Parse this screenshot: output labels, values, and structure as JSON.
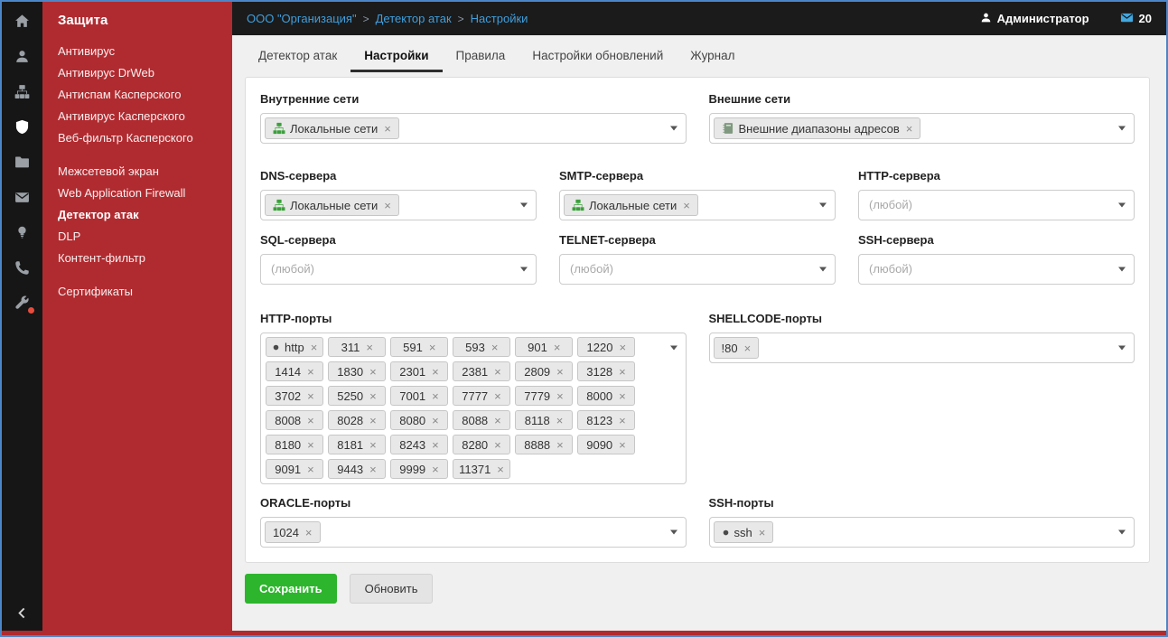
{
  "theme": {
    "border_blue": "#4a86c8",
    "sidebar_red": "#b02b30",
    "iconbar_dark": "#161616",
    "topbar_dark": "#1b1b1b",
    "content_bg": "#f0f0f0",
    "link_blue": "#3f9fdd",
    "save_green": "#2db52d",
    "tag_bg": "#e8e8e8",
    "badge_red": "#e74c3c",
    "mail_blue": "#41a8e0",
    "network_green": "#3ba03b",
    "book_gray": "#7f987f",
    "dot_gray": "#4a4a4a"
  },
  "iconbar": {
    "items": [
      {
        "id": "home",
        "icon": "home-icon"
      },
      {
        "id": "users",
        "icon": "user-icon"
      },
      {
        "id": "network",
        "icon": "network-icon"
      },
      {
        "id": "protection",
        "icon": "shield-icon",
        "active": true
      },
      {
        "id": "files",
        "icon": "folder-icon"
      },
      {
        "id": "mail",
        "icon": "mail-icon"
      },
      {
        "id": "monitoring",
        "icon": "lightbulb-icon"
      },
      {
        "id": "telephony",
        "icon": "phone-icon"
      },
      {
        "id": "services",
        "icon": "wrench-icon",
        "badge": true
      }
    ]
  },
  "sidebar": {
    "title": "Защита",
    "groups": [
      {
        "items": [
          {
            "id": "antivirus",
            "label": "Антивирус"
          },
          {
            "id": "antivirus-drweb",
            "label": "Антивирус DrWeb"
          },
          {
            "id": "antispam-kaspersky",
            "label": "Антиспам Касперского"
          },
          {
            "id": "antivirus-kaspersky",
            "label": "Антивирус Касперского"
          },
          {
            "id": "webfilter-kaspersky",
            "label": "Веб-фильтр Касперского"
          }
        ]
      },
      {
        "items": [
          {
            "id": "firewall",
            "label": "Межсетевой экран"
          },
          {
            "id": "waf",
            "label": "Web Application Firewall"
          },
          {
            "id": "attack-detector",
            "label": "Детектор атак",
            "active": true
          },
          {
            "id": "dlp",
            "label": "DLP"
          },
          {
            "id": "content-filter",
            "label": "Контент-фильтр"
          }
        ]
      },
      {
        "items": [
          {
            "id": "certificates",
            "label": "Сертификаты"
          }
        ]
      }
    ]
  },
  "topbar": {
    "breadcrumb": [
      "ООО \"Организация\"",
      "Детектор атак",
      "Настройки"
    ],
    "separator": ">",
    "user": "Администратор",
    "mail_count": "20"
  },
  "tabs": [
    {
      "id": "attack-detector",
      "label": "Детектор атак"
    },
    {
      "id": "settings",
      "label": "Настройки",
      "active": true
    },
    {
      "id": "rules",
      "label": "Правила"
    },
    {
      "id": "update-settings",
      "label": "Настройки обновлений"
    },
    {
      "id": "journal",
      "label": "Журнал"
    }
  ],
  "form": {
    "rows": [
      {
        "cols": 2,
        "fields": [
          {
            "id": "internal-networks",
            "label": "Внутренние сети",
            "tags": [
              {
                "icon": "network-icon",
                "text": "Локальные сети"
              }
            ]
          },
          {
            "id": "external-networks",
            "label": "Внешние сети",
            "tags": [
              {
                "icon": "book-icon",
                "text": "Внешние диапазоны адресов"
              }
            ]
          }
        ]
      },
      {
        "cols": 3,
        "fields": [
          {
            "id": "dns-servers",
            "label": "DNS-сервера",
            "tags": [
              {
                "icon": "network-icon",
                "text": "Локальные сети"
              }
            ]
          },
          {
            "id": "smtp-servers",
            "label": "SMTP-сервера",
            "tags": [
              {
                "icon": "network-icon",
                "text": "Локальные сети"
              }
            ]
          },
          {
            "id": "http-servers",
            "label": "HTTP-сервера",
            "placeholder": "(любой)"
          }
        ]
      },
      {
        "cols": 3,
        "fields": [
          {
            "id": "sql-servers",
            "label": "SQL-сервера",
            "placeholder": "(любой)"
          },
          {
            "id": "telnet-servers",
            "label": "TELNET-сервера",
            "placeholder": "(любой)"
          },
          {
            "id": "ssh-servers",
            "label": "SSH-сервера",
            "placeholder": "(любой)"
          }
        ]
      },
      {
        "cols": 2,
        "fields": [
          {
            "id": "http-ports",
            "label": "HTTP-порты",
            "tall": true,
            "tags": [
              {
                "icon": "dot-icon",
                "text": "http"
              },
              {
                "text": "311"
              },
              {
                "text": "591"
              },
              {
                "text": "593"
              },
              {
                "text": "901"
              },
              {
                "text": "1220"
              },
              {
                "text": "1414"
              },
              {
                "text": "1830"
              },
              {
                "text": "2301"
              },
              {
                "text": "2381"
              },
              {
                "text": "2809"
              },
              {
                "text": "3128"
              },
              {
                "text": "3702"
              },
              {
                "text": "5250"
              },
              {
                "text": "7001"
              },
              {
                "text": "7777"
              },
              {
                "text": "7779"
              },
              {
                "text": "8000"
              },
              {
                "text": "8008"
              },
              {
                "text": "8028"
              },
              {
                "text": "8080"
              },
              {
                "text": "8088"
              },
              {
                "text": "8118"
              },
              {
                "text": "8123"
              },
              {
                "text": "8180"
              },
              {
                "text": "8181"
              },
              {
                "text": "8243"
              },
              {
                "text": "8280"
              },
              {
                "text": "8888"
              },
              {
                "text": "9090"
              },
              {
                "text": "9091"
              },
              {
                "text": "9443"
              },
              {
                "text": "9999"
              },
              {
                "text": "11371"
              }
            ]
          },
          {
            "id": "shellcode-ports",
            "label": "SHELLCODE-порты",
            "tags": [
              {
                "text": "!80"
              }
            ]
          }
        ]
      },
      {
        "cols": 2,
        "fields": [
          {
            "id": "oracle-ports",
            "label": "ORACLE-порты",
            "tags": [
              {
                "text": "1024"
              }
            ]
          },
          {
            "id": "ssh-ports",
            "label": "SSH-порты",
            "tags": [
              {
                "icon": "dot-icon",
                "text": "ssh"
              }
            ]
          }
        ]
      }
    ]
  },
  "buttons": {
    "save": "Сохранить",
    "refresh": "Обновить"
  }
}
